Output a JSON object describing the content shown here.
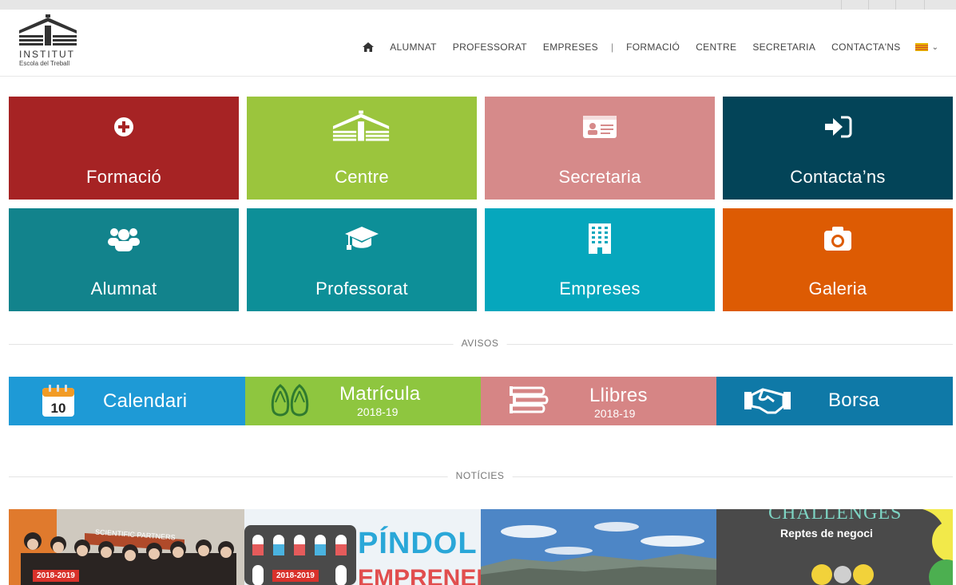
{
  "logo": {
    "title": "INSTITUT",
    "subtitle": "Escola del Treball"
  },
  "nav": {
    "items": [
      "ALUMNAT",
      "PROFESSORAT",
      "EMPRESES",
      "|",
      "FORMACIÓ",
      "CENTRE",
      "SECRETARIA",
      "CONTACTA'NS"
    ]
  },
  "tiles": [
    {
      "label": "Formació",
      "color": "#a62324"
    },
    {
      "label": "Centre",
      "color": "#9bc53d"
    },
    {
      "label": "Secretaria",
      "color": "#d68a8a"
    },
    {
      "label": "Contacta’ns",
      "color": "#034458"
    },
    {
      "label": "Alumnat",
      "color": "#12838c"
    },
    {
      "label": "Professorat",
      "color": "#0d8f98"
    },
    {
      "label": "Empreses",
      "color": "#06a7bd"
    },
    {
      "label": "Galeria",
      "color": "#dd5b03"
    }
  ],
  "sections": {
    "avisos": "AVISOS",
    "noticies": "NOTÍCIES"
  },
  "avisos": [
    {
      "label": "Calendari",
      "sub": "",
      "icon_day": "10",
      "color": "#1e9ad6"
    },
    {
      "label": "Matrícula",
      "sub": "2018-19",
      "color": "#8ec63f"
    },
    {
      "label": "Llibres",
      "sub": "2018-19",
      "color": "#d68585"
    },
    {
      "label": "Borsa",
      "sub": "",
      "color": "#0f79a7"
    }
  ],
  "news": [
    {
      "badge": "2018-2019",
      "banner": "SCIENTIFIC PARTNERS"
    },
    {
      "badge": "2018-2019",
      "line1": "PÍNDOL",
      "line2": "EMPRENEDO"
    },
    {
      "badge": ""
    },
    {
      "badge": "",
      "title": "CHALLENGES",
      "subtitle": "Reptes de negoci"
    }
  ]
}
